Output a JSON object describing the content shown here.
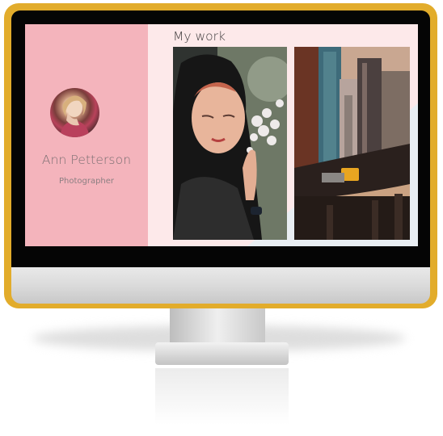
{
  "profile": {
    "name": "Ann Petterson",
    "role": "Photographer",
    "avatar_icon": "person-portrait-icon"
  },
  "main": {
    "title": "My work",
    "gallery": [
      {
        "subject": "woman-with-flowers-photo"
      },
      {
        "subject": "city-train-skyscrapers-photo"
      }
    ]
  },
  "colors": {
    "frame": "#e2ac2b",
    "sidebar": "#f4b4bc",
    "content_bg": "#fde9ea"
  }
}
